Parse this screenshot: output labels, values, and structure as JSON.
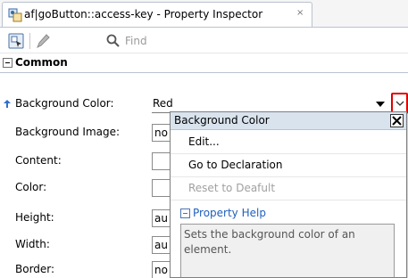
{
  "tab": {
    "title": "af|goButton::access-key - Property Inspector",
    "close_glyph": "×",
    "icon": "skin-selector-icon"
  },
  "toolbar": {
    "search_placeholder": "Find",
    "icons": [
      "select-component-icon",
      "edit-pencil-icon",
      "search-icon"
    ]
  },
  "section": {
    "title": "Common",
    "expanded": true
  },
  "properties": [
    {
      "label": "Background Color:",
      "value": "Red"
    },
    {
      "label": "Background Image:",
      "value": "no"
    },
    {
      "label": "Content:",
      "value": ""
    },
    {
      "label": "Color:",
      "value": ""
    },
    {
      "label": "Height:",
      "value": "au"
    },
    {
      "label": "Width:",
      "value": "au"
    },
    {
      "label": "Border:",
      "value": "no"
    }
  ],
  "popup": {
    "title": "Background Color",
    "items": [
      {
        "label": "Edit...",
        "enabled": true
      },
      {
        "label": "Go to Declaration",
        "enabled": true
      },
      {
        "label": "Reset to Deafult",
        "enabled": false
      }
    ],
    "help_title": "Property Help",
    "help_text": "Sets the background color of an element."
  },
  "colors": {
    "accent_blue": "#1f5fbf",
    "highlight_red": "#e00000",
    "popup_header": "#d9e3ee"
  }
}
